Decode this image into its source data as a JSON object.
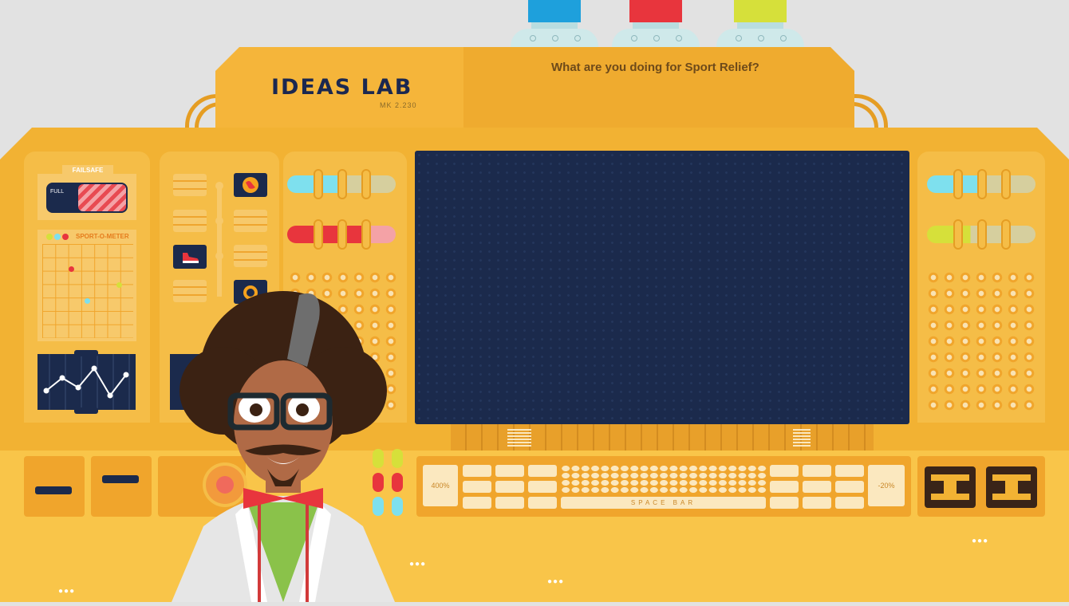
{
  "header": {
    "title": "IDEAS LAB",
    "version": "MK 2.230",
    "question": "What are you doing for Sport Relief?"
  },
  "bottles": [
    {
      "name": "blue",
      "color": "#1ea0dc"
    },
    {
      "name": "red",
      "color": "#e8353d"
    },
    {
      "name": "yellow",
      "color": "#d6e03a"
    }
  ],
  "left_panel": {
    "failsafe_label": "FAILSAFE",
    "failsafe_state": "FULL",
    "sport_meter_label": "SPORT-O-METER"
  },
  "keyboard": {
    "space_bar_label": "SPACE BAR",
    "left_percent": "400%",
    "right_percent": "-20%"
  },
  "colors": {
    "console": "#f2b233",
    "screen": "#1b2a4c",
    "accent_red": "#e8353d",
    "accent_cyan": "#7ee0ee"
  }
}
